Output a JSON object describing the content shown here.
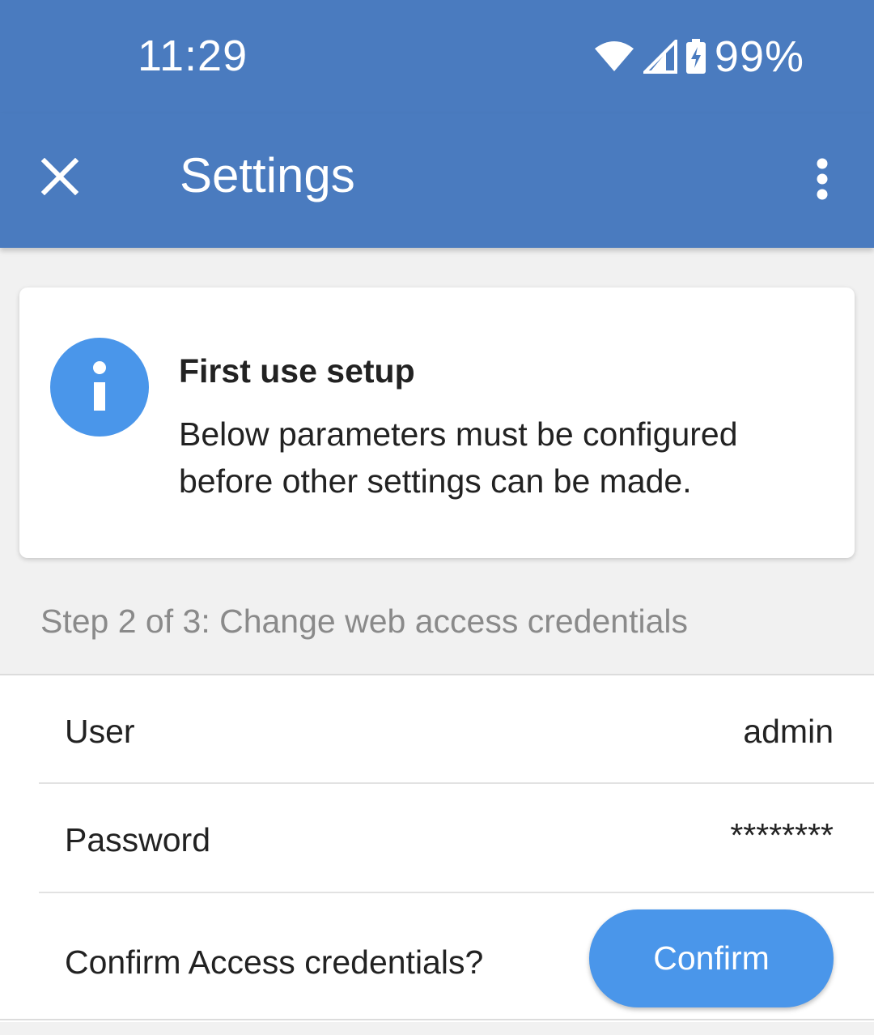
{
  "status_bar": {
    "time": "11:29",
    "battery": "99%",
    "icons": [
      "wifi-icon",
      "cell-signal-icon",
      "battery-charging-icon"
    ]
  },
  "app_bar": {
    "title": "Settings",
    "close_icon": "close-icon",
    "menu_icon": "more-vert-icon"
  },
  "info_card": {
    "icon": "info-icon",
    "title": "First use setup",
    "body": "Below parameters must be configured before other settings can be made."
  },
  "step_label": "Step 2 of 3: Change web access credentials",
  "credentials": {
    "user_label": "User",
    "user_value": "admin",
    "password_label": "Password",
    "password_value": "********",
    "confirm_prompt": "Confirm Access credentials?",
    "confirm_button": "Confirm"
  },
  "colors": {
    "app_bar": "#4a7bbf",
    "accent": "#4a96ea",
    "background": "#f1f1f1"
  }
}
